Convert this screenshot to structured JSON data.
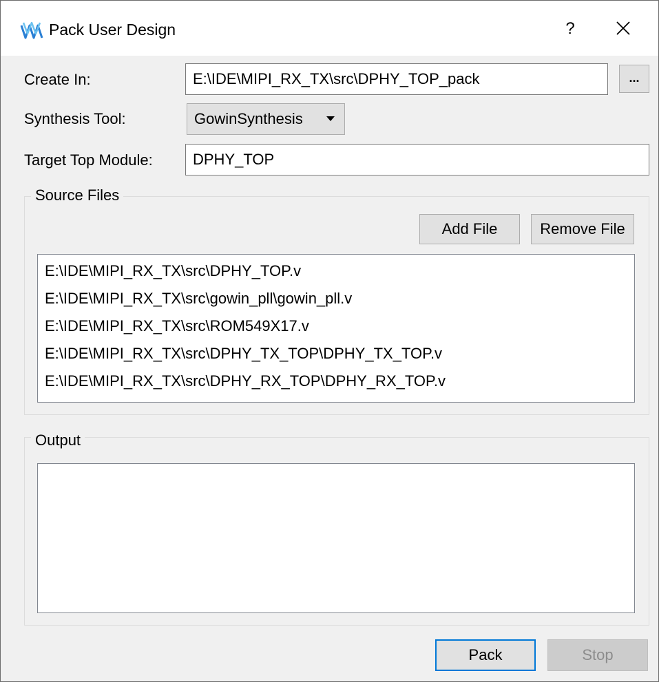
{
  "window": {
    "title": "Pack User Design",
    "help_label": "?",
    "icon": "gowin-logo-icon",
    "accent_color": "#0078d7"
  },
  "form": {
    "create_in_label": "Create In:",
    "create_in_value": "E:\\IDE\\MIPI_RX_TX\\src\\DPHY_TOP_pack",
    "browse_label": "...",
    "synthesis_tool_label": "Synthesis Tool:",
    "synthesis_tool_value": "GowinSynthesis",
    "target_top_label": "Target Top Module:",
    "target_top_value": "DPHY_TOP"
  },
  "source_files": {
    "title": "Source Files",
    "add_label": "Add File",
    "remove_label": "Remove File",
    "files": [
      "E:\\IDE\\MIPI_RX_TX\\src\\DPHY_TOP.v",
      "E:\\IDE\\MIPI_RX_TX\\src\\gowin_pll\\gowin_pll.v",
      "E:\\IDE\\MIPI_RX_TX\\src\\ROM549X17.v",
      "E:\\IDE\\MIPI_RX_TX\\src\\DPHY_TX_TOP\\DPHY_TX_TOP.v",
      "E:\\IDE\\MIPI_RX_TX\\src\\DPHY_RX_TOP\\DPHY_RX_TOP.v"
    ]
  },
  "output": {
    "title": "Output",
    "text": ""
  },
  "actions": {
    "pack_label": "Pack",
    "stop_label": "Stop"
  }
}
